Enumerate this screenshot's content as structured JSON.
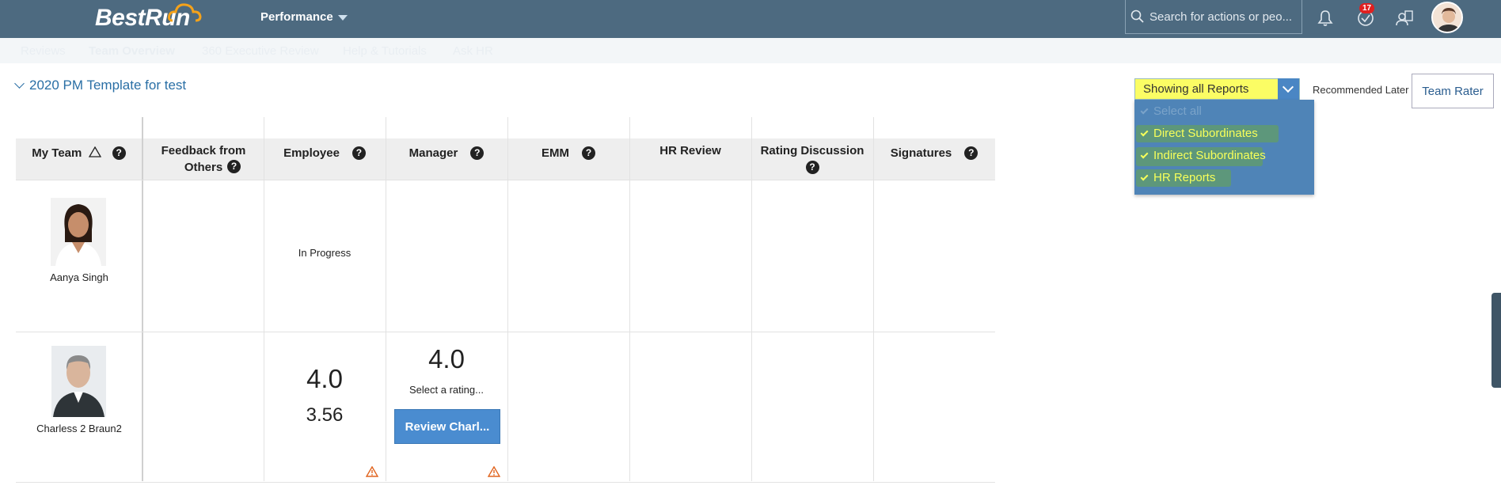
{
  "shell": {
    "logo": "BestRun",
    "module": "Performance",
    "search_placeholder": "Search for actions or peo...",
    "notification_badge": "17"
  },
  "subnav": {
    "items": [
      "Reviews",
      "Team Overview",
      "360 Executive Review",
      "Help & Tutorials",
      "Ask HR"
    ]
  },
  "page": {
    "template_title": "2020 PM Template for test",
    "filter_value": "Showing all Reports",
    "filter_options": [
      "Select all",
      "Direct Subordinates",
      "Indirect Subordinates",
      "HR Reports"
    ],
    "recommended_label": "Recommended Later",
    "team_rater_label": "Team Rater"
  },
  "table": {
    "columns": [
      "My Team",
      "Feedback from Others",
      "Employee",
      "Manager",
      "EMM",
      "HR Review",
      "Rating Discussion",
      "Signatures"
    ],
    "rows": [
      {
        "name": "Aanya Singh",
        "employee_status": "In Progress"
      },
      {
        "name": "Charless 2 Braun2",
        "employee_rating": "4.0",
        "employee_score": "3.56",
        "manager_rating": "4.0",
        "manager_hint": "Select a rating...",
        "review_button": "Review Charl..."
      }
    ]
  },
  "colors": {
    "shell": "#4d6a80",
    "accent_blue": "#4a8cd0",
    "highlight_yellow": "#fbfd64",
    "warning": "#e0641e"
  }
}
